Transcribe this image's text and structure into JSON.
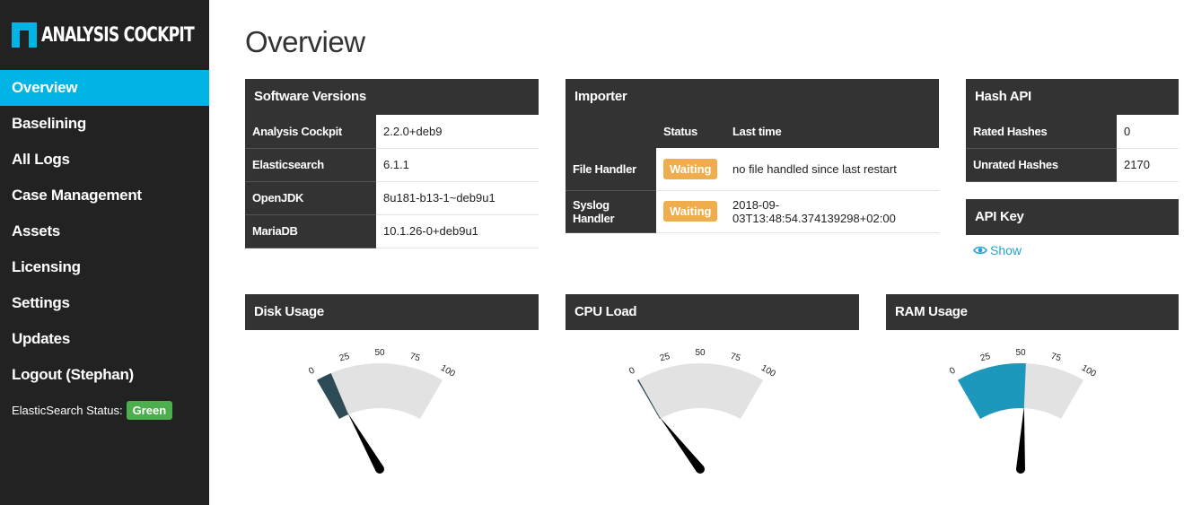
{
  "brand": {
    "name": "ANALYSIS COCKPIT",
    "accent": "#00b4e6"
  },
  "nav": {
    "items": [
      {
        "label": "Overview",
        "active": true
      },
      {
        "label": "Baselining"
      },
      {
        "label": "All Logs"
      },
      {
        "label": "Case Management"
      },
      {
        "label": "Assets"
      },
      {
        "label": "Licensing"
      },
      {
        "label": "Settings"
      },
      {
        "label": "Updates"
      },
      {
        "label": "Logout (Stephan)"
      }
    ]
  },
  "es_status": {
    "label": "ElasticSearch Status:",
    "value": "Green",
    "color": "#4cae4c"
  },
  "page_title": "Overview",
  "software_versions": {
    "title": "Software Versions",
    "rows": [
      {
        "name": "Analysis Cockpit",
        "value": "2.2.0+deb9"
      },
      {
        "name": "Elasticsearch",
        "value": "6.1.1"
      },
      {
        "name": "OpenJDK",
        "value": "8u181-b13-1~deb9u1"
      },
      {
        "name": "MariaDB",
        "value": "10.1.26-0+deb9u1"
      }
    ]
  },
  "importer": {
    "title": "Importer",
    "columns": [
      "",
      "Status",
      "Last time"
    ],
    "rows": [
      {
        "name": "File Handler",
        "status": "Waiting",
        "last_time": "no file handled since last restart"
      },
      {
        "name": "Syslog Handler",
        "status": "Waiting",
        "last_time": "2018-09-03T13:48:54.374139298+02:00"
      }
    ]
  },
  "hash_api": {
    "title": "Hash API",
    "rows": [
      {
        "name": "Rated Hashes",
        "value": "0"
      },
      {
        "name": "Unrated Hashes",
        "value": "2170"
      }
    ]
  },
  "api_key": {
    "title": "API Key",
    "show_label": "Show"
  },
  "gauges": [
    {
      "title": "Disk Usage",
      "value": 12,
      "fill": "#2d4b55",
      "icon": "gauge"
    },
    {
      "title": "CPU Load",
      "value": 1,
      "fill": "#2d4b55",
      "icon": "gauge"
    },
    {
      "title": "RAM Usage",
      "value": 54,
      "fill": "#1e97bd",
      "icon": "gauge"
    }
  ],
  "gauge_ticks": [
    "0",
    "25",
    "50",
    "75",
    "100"
  ],
  "colors": {
    "panel_header": "#333333",
    "waiting": "#f0ad4e",
    "gauge_track": "#e2e2e2"
  }
}
